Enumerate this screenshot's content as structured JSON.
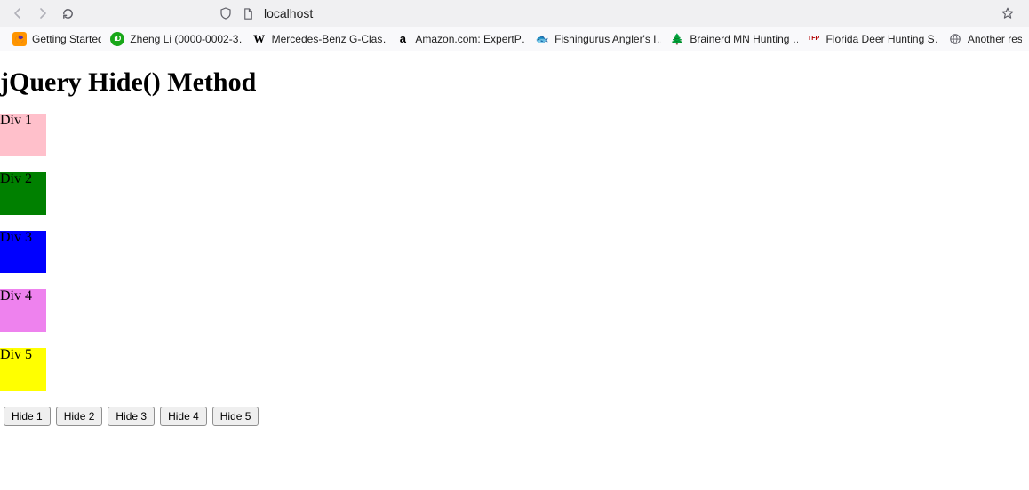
{
  "browser": {
    "url": "localhost",
    "bookmarks": [
      {
        "label": "Getting Started",
        "icon_bg": "#ff9500",
        "icon_fg": "#ffffff",
        "icon_text": ""
      },
      {
        "label": "Zheng Li (0000-0002-3…",
        "icon_bg": "#18a718",
        "icon_fg": "#ffffff",
        "icon_text": "iD"
      },
      {
        "label": "Mercedes-Benz G-Clas…",
        "icon_bg": "#ffffff",
        "icon_fg": "#000000",
        "icon_text": "W"
      },
      {
        "label": "Amazon.com: ExpertP…",
        "icon_bg": "#ffffff",
        "icon_fg": "#000000",
        "icon_text": "a"
      },
      {
        "label": "Fishingurus Angler's I…",
        "icon_bg": "#ffffff",
        "icon_fg": "#5a462e",
        "icon_text": "🐟"
      },
      {
        "label": "Brainerd MN Hunting …",
        "icon_bg": "#ffffff",
        "icon_fg": "#0a5a0a",
        "icon_text": "🌲"
      },
      {
        "label": "Florida Deer Hunting S…",
        "icon_bg": "#ffffff",
        "icon_fg": "#b00000",
        "icon_text": "TFP"
      },
      {
        "label": "Another res",
        "icon_bg": "",
        "icon_fg": "#5e5e66",
        "icon_text": "globe"
      }
    ]
  },
  "page": {
    "heading": "jQuery Hide() Method",
    "divs": [
      {
        "label": "Div 1",
        "color": "#ffc0cb"
      },
      {
        "label": "Div 2",
        "color": "#008000"
      },
      {
        "label": "Div 3",
        "color": "#0000ff"
      },
      {
        "label": "Div 4",
        "color": "#ee82ee"
      },
      {
        "label": "Div 5",
        "color": "#ffff00"
      }
    ],
    "buttons": [
      {
        "label": "Hide 1"
      },
      {
        "label": "Hide 2"
      },
      {
        "label": "Hide 3"
      },
      {
        "label": "Hide 4"
      },
      {
        "label": "Hide 5"
      }
    ]
  }
}
